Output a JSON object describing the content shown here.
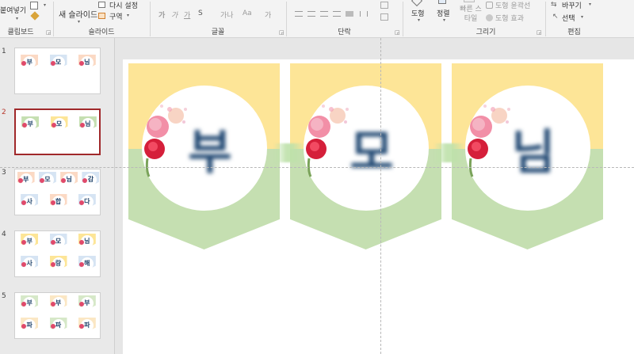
{
  "ribbon": {
    "clipboard": {
      "paste_label": "붙여넣기",
      "group_label": "클립보드"
    },
    "slides": {
      "new_slide_label": "새 슬라이드",
      "reset_label": "다시 설정",
      "section_label": "구역",
      "group_label": "슬라이드"
    },
    "font": {
      "bold_label": "가",
      "italic_label": "가",
      "underline_label": "가",
      "strike_label": "S",
      "spacing_label": "가나",
      "case_label": "Aa",
      "color_label": "가",
      "group_label": "글꼴"
    },
    "paragraph": {
      "group_label": "단락"
    },
    "drawing": {
      "shapes_label": "도형",
      "arrange_label": "정렬",
      "quick_styles_label": "빠른 스타일",
      "outline_label": "도형 윤곽선",
      "effects_label": "도형 효과",
      "group_label": "그리기"
    },
    "editing": {
      "replace_label": "바꾸기",
      "select_label": "선택",
      "group_label": "편집"
    }
  },
  "thumbnails": [
    {
      "number": "1",
      "selected": false,
      "rows": [
        [
          "부",
          "모",
          "님"
        ]
      ]
    },
    {
      "number": "2",
      "selected": true,
      "rows": [
        [
          "부",
          "모",
          "님"
        ]
      ]
    },
    {
      "number": "3",
      "selected": false,
      "rows": [
        [
          "부",
          "모",
          "님",
          "감"
        ],
        [
          "사",
          "합",
          "다"
        ]
      ]
    },
    {
      "number": "4",
      "selected": false,
      "rows": [
        [
          "부",
          "모",
          "님"
        ],
        [
          "사",
          "랑",
          "해"
        ]
      ]
    },
    {
      "number": "5",
      "selected": false,
      "rows": [
        [
          "부",
          "부",
          "부"
        ],
        [
          "파",
          "파",
          "파"
        ]
      ]
    }
  ],
  "slide": {
    "banners": [
      {
        "letter": "부"
      },
      {
        "letter": "모"
      },
      {
        "letter": "님"
      }
    ]
  },
  "colors": {
    "banner_top": "#fde597",
    "banner_bottom": "#c5dfb1",
    "letter": "#234a74",
    "selection": "#a0282a"
  }
}
